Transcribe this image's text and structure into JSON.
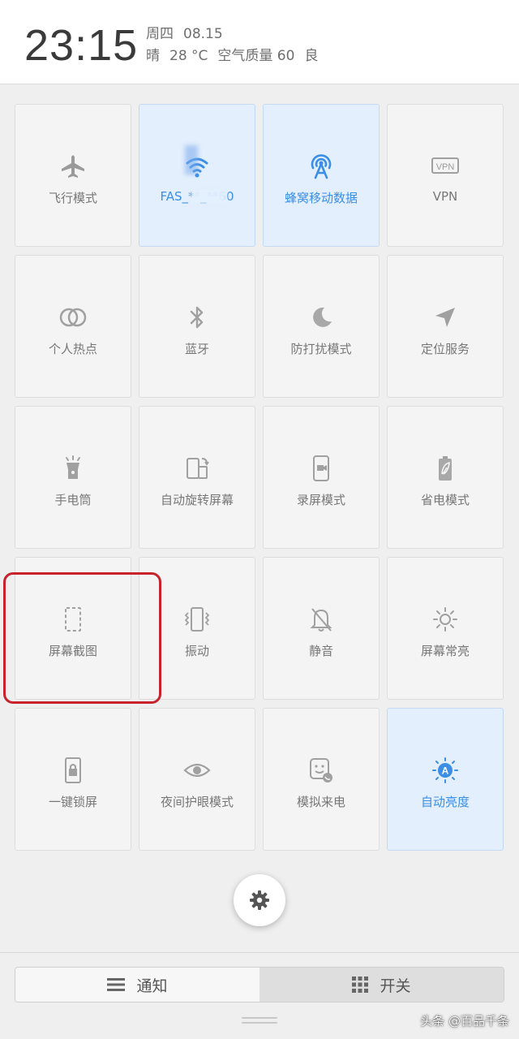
{
  "status": {
    "time": "23:15",
    "weekday": "周四",
    "date": "08.15",
    "weather": "晴",
    "temperature": "28 °C",
    "air_quality_label": "空气质量 60",
    "air_quality_level": "良"
  },
  "toggles": [
    {
      "label": "飞行模式",
      "icon": "airplane-icon",
      "active": false
    },
    {
      "label": "FAS_**_**60",
      "icon": "wifi-icon",
      "active": true
    },
    {
      "label": "蜂窝移动数据",
      "icon": "cellular-antenna-icon",
      "active": true
    },
    {
      "label": "VPN",
      "icon": "vpn-icon",
      "active": false
    },
    {
      "label": "个人热点",
      "icon": "hotspot-icon",
      "active": false
    },
    {
      "label": "蓝牙",
      "icon": "bluetooth-icon",
      "active": false
    },
    {
      "label": "防打扰模式",
      "icon": "moon-icon",
      "active": false
    },
    {
      "label": "定位服务",
      "icon": "location-arrow-icon",
      "active": false
    },
    {
      "label": "手电筒",
      "icon": "flashlight-icon",
      "active": false
    },
    {
      "label": "自动旋转屏幕",
      "icon": "rotate-screen-icon",
      "active": false
    },
    {
      "label": "录屏模式",
      "icon": "screen-record-icon",
      "active": false
    },
    {
      "label": "省电模式",
      "icon": "battery-saver-icon",
      "active": false
    },
    {
      "label": "屏幕截图",
      "icon": "screenshot-icon",
      "active": false
    },
    {
      "label": "振动",
      "icon": "vibrate-icon",
      "active": false
    },
    {
      "label": "静音",
      "icon": "mute-bell-icon",
      "active": false
    },
    {
      "label": "屏幕常亮",
      "icon": "sun-icon",
      "active": false
    },
    {
      "label": "一键锁屏",
      "icon": "lock-screen-icon",
      "active": false
    },
    {
      "label": "夜间护眼模式",
      "icon": "eye-icon",
      "active": false
    },
    {
      "label": "模拟来电",
      "icon": "fake-call-icon",
      "active": false
    },
    {
      "label": "自动亮度",
      "icon": "auto-brightness-icon",
      "active": true
    }
  ],
  "settings_button": {
    "icon": "gear-icon"
  },
  "tabs": {
    "notifications": {
      "label": "通知",
      "icon": "list-icon",
      "selected": false
    },
    "toggles": {
      "label": "开关",
      "icon": "grid-icon",
      "selected": true
    }
  },
  "watermark": "头条 @百品千条",
  "colors": {
    "accent": "#3a8ee6",
    "active_tile": "#e3effd",
    "highlight": "#c8232c"
  }
}
